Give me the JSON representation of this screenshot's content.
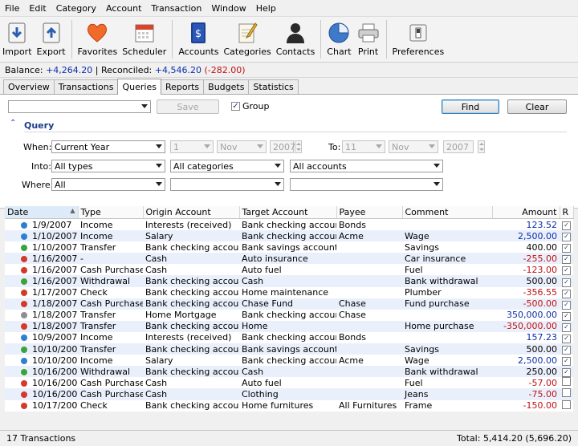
{
  "menu": [
    "File",
    "Edit",
    "Category",
    "Account",
    "Transaction",
    "Window",
    "Help"
  ],
  "toolbar": [
    {
      "label": "Import",
      "icon": "import-icon"
    },
    {
      "label": "Export",
      "icon": "export-icon"
    },
    {
      "label": "Favorites",
      "icon": "heart-icon"
    },
    {
      "label": "Scheduler",
      "icon": "calendar-icon"
    },
    {
      "label": "Accounts",
      "icon": "ledger-icon"
    },
    {
      "label": "Categories",
      "icon": "notepad-icon"
    },
    {
      "label": "Contacts",
      "icon": "person-icon"
    },
    {
      "label": "Chart",
      "icon": "pie-chart-icon"
    },
    {
      "label": "Print",
      "icon": "printer-icon"
    },
    {
      "label": "Preferences",
      "icon": "switch-icon"
    }
  ],
  "balance": {
    "balance_label": "Balance:",
    "balance_value": "+4,264.20",
    "sep": " | ",
    "reconciled_label": "Reconciled:",
    "reconciled_value": "+4,546.20",
    "reconciled_diff": "(-282.00)"
  },
  "tabs": [
    "Overview",
    "Transactions",
    "Queries",
    "Reports",
    "Budgets",
    "Statistics"
  ],
  "active_tab": "Queries",
  "query": {
    "saved_query_value": "",
    "save_label": "Save",
    "group_label": "Group",
    "group_checked": true,
    "find_label": "Find",
    "clear_label": "Clear",
    "section_label": "Query",
    "when_label": "When:",
    "when_value": "Current Year",
    "from_day": "1",
    "from_month": "Nov",
    "from_year": "2007",
    "to_label": "To:",
    "to_day": "11",
    "to_month": "Nov",
    "to_year": "2007",
    "into_label": "Into:",
    "types_value": "All types",
    "categories_value": "All categories",
    "accounts_value": "All accounts",
    "where_label": "Where:",
    "where_value": "All",
    "where_field2": "",
    "where_field3": ""
  },
  "columns": [
    "Date",
    "Type",
    "Origin Account",
    "Target Account",
    "Payee",
    "Comment",
    "Amount",
    "R"
  ],
  "colors": {
    "income": "#2f7fd0",
    "transfer": "#3aa33a",
    "expense": "#d23a2a",
    "neutral": "#8e8e8e",
    "negative": "#c01010",
    "accent": "#0b2fa8"
  },
  "rows": [
    {
      "kind": "income",
      "date": "1/9/2007",
      "type": "Income",
      "origin": "Interests (received)",
      "target": "Bank checking account",
      "payee": "Bonds",
      "comment": "",
      "amount": "123.52",
      "amt_style": "hi",
      "r": true
    },
    {
      "kind": "income",
      "date": "1/10/2007",
      "type": "Income",
      "origin": "Salary",
      "target": "Bank checking account",
      "payee": "Acme",
      "comment": "Wage",
      "amount": "2,500.00",
      "amt_style": "hi",
      "r": true
    },
    {
      "kind": "transfer",
      "date": "1/10/2007",
      "type": "Transfer",
      "origin": "Bank checking account",
      "target": "Bank savings account",
      "payee": "",
      "comment": "Savings",
      "amount": "400.00",
      "amt_style": "pos",
      "r": true
    },
    {
      "kind": "expense",
      "date": "1/16/2007",
      "type": "-",
      "origin": "Cash",
      "target": "Auto insurance",
      "payee": "",
      "comment": "Car insurance",
      "amount": "-255.00",
      "amt_style": "neg",
      "r": true
    },
    {
      "kind": "expense",
      "date": "1/16/2007",
      "type": "Cash Purchase",
      "origin": "Cash",
      "target": "Auto fuel",
      "payee": "",
      "comment": "Fuel",
      "amount": "-123.00",
      "amt_style": "neg",
      "r": true
    },
    {
      "kind": "transfer",
      "date": "1/16/2007",
      "type": "Withdrawal",
      "origin": "Bank checking account",
      "target": "Cash",
      "payee": "",
      "comment": "Bank withdrawal",
      "amount": "500.00",
      "amt_style": "pos",
      "r": true
    },
    {
      "kind": "expense",
      "date": "1/17/2007",
      "type": "Check",
      "origin": "Bank checking account",
      "target": "Home maintenance",
      "payee": "",
      "comment": "Plumber",
      "amount": "-356.55",
      "amt_style": "neg",
      "r": true
    },
    {
      "kind": "expense",
      "date": "1/18/2007",
      "type": "Cash Purchase",
      "origin": "Bank checking account",
      "target": "Chase Fund",
      "payee": "Chase",
      "comment": "Fund purchase",
      "amount": "-500.00",
      "amt_style": "neg",
      "r": true
    },
    {
      "kind": "neutral",
      "date": "1/18/2007",
      "type": "Transfer",
      "origin": "Home Mortgage",
      "target": "Bank checking account",
      "payee": "Chase",
      "comment": "",
      "amount": "350,000.00",
      "amt_style": "hi",
      "r": true
    },
    {
      "kind": "expense",
      "date": "1/18/2007",
      "type": "Transfer",
      "origin": "Bank checking account",
      "target": "Home",
      "payee": "",
      "comment": "Home purchase",
      "amount": "-350,000.00",
      "amt_style": "neg",
      "r": true
    },
    {
      "kind": "income",
      "date": "10/9/2007",
      "type": "Income",
      "origin": "Interests (received)",
      "target": "Bank checking account",
      "payee": "Bonds",
      "comment": "",
      "amount": "157.23",
      "amt_style": "hi",
      "r": true
    },
    {
      "kind": "transfer",
      "date": "10/10/2007",
      "type": "Transfer",
      "origin": "Bank checking account",
      "target": "Bank savings account",
      "payee": "",
      "comment": "Savings",
      "amount": "500.00",
      "amt_style": "pos",
      "r": true
    },
    {
      "kind": "income",
      "date": "10/10/2007",
      "type": "Income",
      "origin": "Salary",
      "target": "Bank checking account",
      "payee": "Acme",
      "comment": "Wage",
      "amount": "2,500.00",
      "amt_style": "hi",
      "r": true
    },
    {
      "kind": "transfer",
      "date": "10/16/2007",
      "type": "Withdrawal",
      "origin": "Bank checking account",
      "target": "Cash",
      "payee": "",
      "comment": "Bank withdrawal",
      "amount": "250.00",
      "amt_style": "pos",
      "r": true
    },
    {
      "kind": "expense",
      "date": "10/16/2007",
      "type": "Cash Purchase",
      "origin": "Cash",
      "target": "Auto fuel",
      "payee": "",
      "comment": "Fuel",
      "amount": "-57.00",
      "amt_style": "neg",
      "r": false
    },
    {
      "kind": "expense",
      "date": "10/16/2007",
      "type": "Cash Purchase",
      "origin": "Cash",
      "target": "Clothing",
      "payee": "",
      "comment": "Jeans",
      "amount": "-75.00",
      "amt_style": "neg",
      "r": false
    },
    {
      "kind": "expense",
      "date": "10/17/2007",
      "type": "Check",
      "origin": "Bank checking account",
      "target": "Home furnitures",
      "payee": "All Furnitures",
      "comment": "Frame",
      "amount": "-150.00",
      "amt_style": "neg",
      "r": false
    }
  ],
  "status": {
    "count": "17 Transactions",
    "total": "Total: 5,414.20 (5,696.20)"
  }
}
